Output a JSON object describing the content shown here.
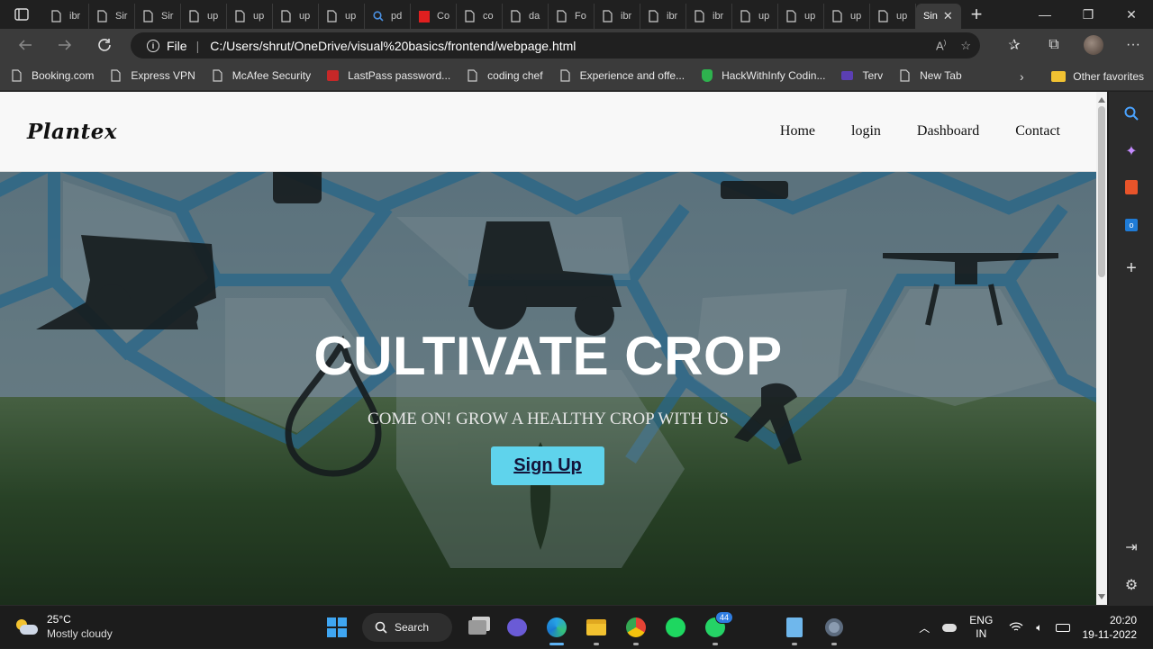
{
  "browser": {
    "tabs": [
      {
        "title": "ibr",
        "icon": "page-icon"
      },
      {
        "title": "Sir",
        "icon": "page-icon"
      },
      {
        "title": "Sir",
        "icon": "page-icon"
      },
      {
        "title": "up",
        "icon": "page-icon"
      },
      {
        "title": "up",
        "icon": "page-icon"
      },
      {
        "title": "up",
        "icon": "page-icon"
      },
      {
        "title": "up",
        "icon": "page-icon"
      },
      {
        "title": "pd",
        "icon": "search-icon"
      },
      {
        "title": "Co",
        "icon": "adobe-icon"
      },
      {
        "title": "co",
        "icon": "page-icon"
      },
      {
        "title": "da",
        "icon": "page-icon"
      },
      {
        "title": "Fo",
        "icon": "page-icon"
      },
      {
        "title": "ibr",
        "icon": "page-icon"
      },
      {
        "title": "ibr",
        "icon": "page-icon"
      },
      {
        "title": "ibr",
        "icon": "page-icon"
      },
      {
        "title": "up",
        "icon": "page-icon"
      },
      {
        "title": "up",
        "icon": "page-icon"
      },
      {
        "title": "up",
        "icon": "page-icon"
      },
      {
        "title": "up",
        "icon": "page-icon"
      }
    ],
    "active_tab": {
      "title": "Sin"
    },
    "address": {
      "scheme": "File",
      "url": "C:/Users/shrut/OneDrive/visual%20basics/frontend/webpage.html"
    },
    "bookmarks": [
      {
        "label": "Booking.com",
        "icon": "page-icon"
      },
      {
        "label": "Express VPN",
        "icon": "page-icon"
      },
      {
        "label": "McAfee Security",
        "icon": "page-icon"
      },
      {
        "label": "LastPass password...",
        "icon": "lastpass-icon"
      },
      {
        "label": "coding chef",
        "icon": "page-icon"
      },
      {
        "label": "Experience and offe...",
        "icon": "page-icon"
      },
      {
        "label": "HackWithInfy Codin...",
        "icon": "shield-icon"
      },
      {
        "label": "Terv",
        "icon": "terv-icon"
      },
      {
        "label": "New Tab",
        "icon": "page-icon"
      }
    ],
    "other_favorites": "Other favorites"
  },
  "page": {
    "logo": "Plantex",
    "nav": [
      "Home",
      "login",
      "Dashboard",
      "Contact"
    ],
    "hero": {
      "title": "CULTIVATE CROP",
      "subtitle": "COME ON! GROW A HEALTHY CROP WITH US",
      "cta": "Sign Up"
    }
  },
  "taskbar": {
    "weather": {
      "temp": "25°C",
      "condition": "Mostly cloudy"
    },
    "search_label": "Search",
    "whatsapp_badge": "44",
    "lang": {
      "line1": "ENG",
      "line2": "IN"
    },
    "clock": {
      "time": "20:20",
      "date": "19-11-2022"
    }
  },
  "colors": {
    "cta_bg": "#5fd3ec",
    "chrome_bg": "#202020",
    "toolbar_bg": "#3b3b3b"
  }
}
